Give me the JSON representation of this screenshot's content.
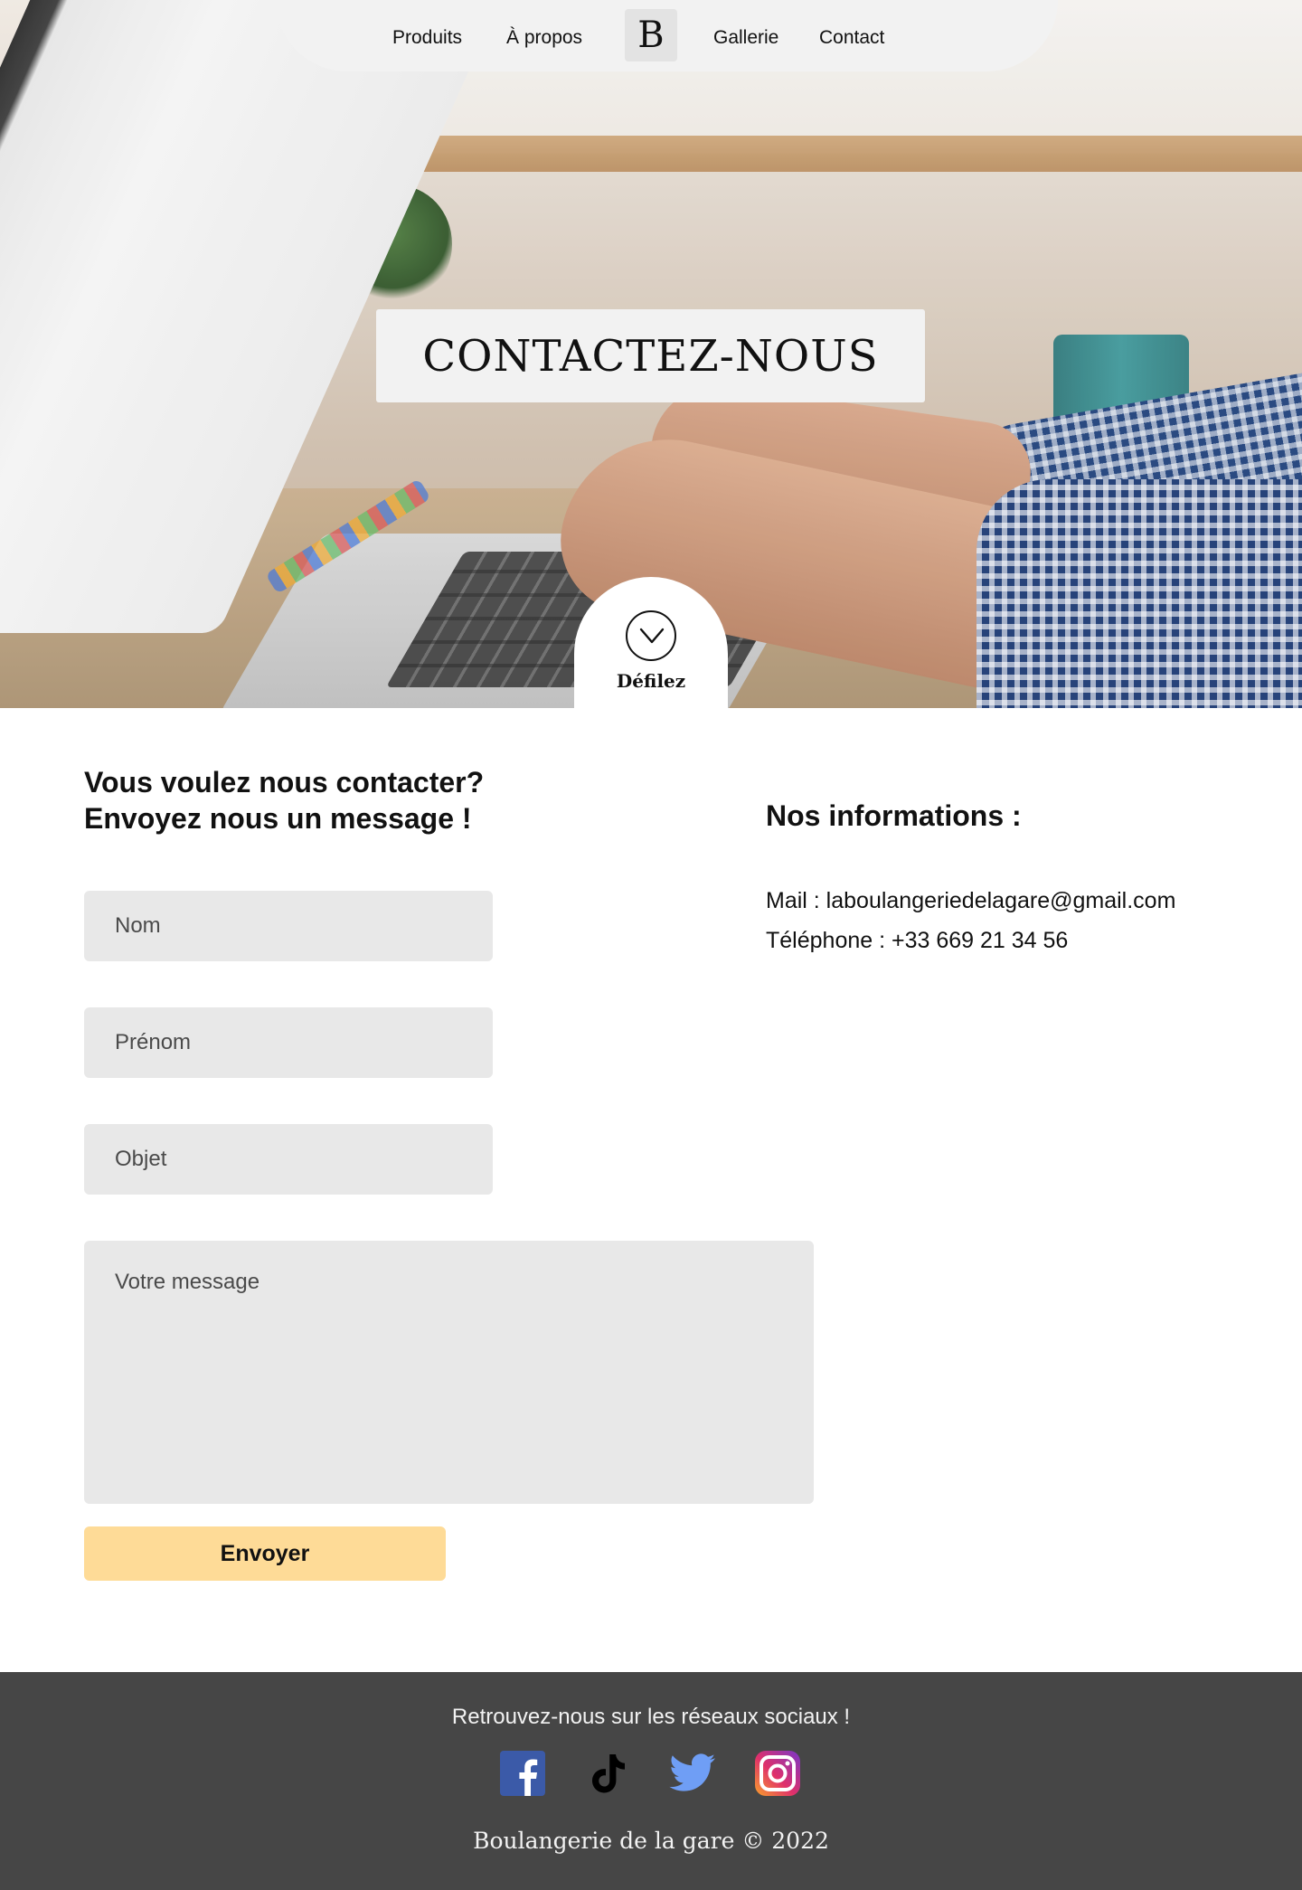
{
  "nav": {
    "items": [
      {
        "label": "Produits"
      },
      {
        "label": "À propos"
      },
      {
        "label": "Gallerie"
      },
      {
        "label": "Contact"
      }
    ],
    "logo": "B"
  },
  "hero": {
    "title": "CONTACTEZ-NOUS",
    "scroll_label": "Défilez"
  },
  "form": {
    "heading_line1": "Vous voulez nous contacter?",
    "heading_line2": "Envoyez nous un message !",
    "fields": {
      "nom": {
        "placeholder": "Nom",
        "value": ""
      },
      "prenom": {
        "placeholder": "Prénom",
        "value": ""
      },
      "objet": {
        "placeholder": "Objet",
        "value": ""
      },
      "message": {
        "placeholder": "Votre message",
        "value": ""
      }
    },
    "submit_label": "Envoyer"
  },
  "info": {
    "heading": "Nos informations :",
    "mail": "Mail : laboulangeriedelagare@gmail.com",
    "phone": "Téléphone : +33 669 21 34 56"
  },
  "footer": {
    "tagline": "Retrouvez-nous sur les réseaux sociaux !",
    "social_icons": [
      "facebook-icon",
      "tiktok-icon",
      "twitter-icon",
      "instagram-icon"
    ],
    "copyright": "Boulangerie de la gare © 2022"
  },
  "colors": {
    "accent_button": "#fedb97",
    "field_background": "#e8e8e8",
    "footer_background": "#464646",
    "nav_background": "#f2f2f2"
  }
}
